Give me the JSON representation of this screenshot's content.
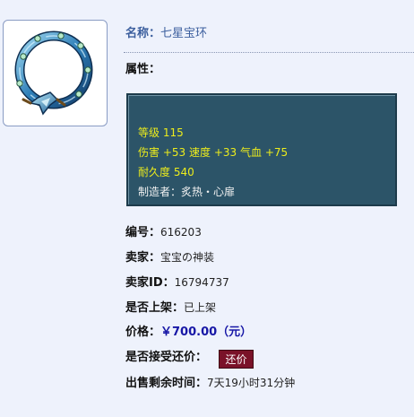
{
  "item": {
    "name_label": "名称：",
    "name": "七星宝环",
    "attributes_label": "属性：",
    "attributes": {
      "level_label": "等级",
      "level": "115",
      "damage_label": "伤害",
      "damage": "+53",
      "speed_label": "速度",
      "speed": "+33",
      "hp_label": "气血",
      "hp": "+75",
      "durability_label": "耐久度",
      "durability": "540",
      "maker_label": "制造者：",
      "maker": "炙热・心扉"
    }
  },
  "listing": {
    "id_label": "编号：",
    "id": "616203",
    "seller_label": "卖家：",
    "seller": "宝宝の神装",
    "seller_id_label": "卖家ID：",
    "seller_id": "16794737",
    "listed_label": "是否上架：",
    "listed": "已上架",
    "price_label": "价格：",
    "price": "￥700.00（元）",
    "bargain_label": "是否接受还价：",
    "bargain_button": "还价",
    "time_left_label": "出售剩余时间：",
    "time_left": "7天19小时31分钟"
  },
  "icons": {
    "item_image": "ring-bracelet-icon"
  },
  "colors": {
    "background": "#eef2fc",
    "name_text": "#3c5f9e",
    "attr_box_bg": "#2c5468",
    "attr_highlight": "#ecec1c",
    "price_text": "#1717a6",
    "bargain_button_bg": "#7a1228"
  }
}
